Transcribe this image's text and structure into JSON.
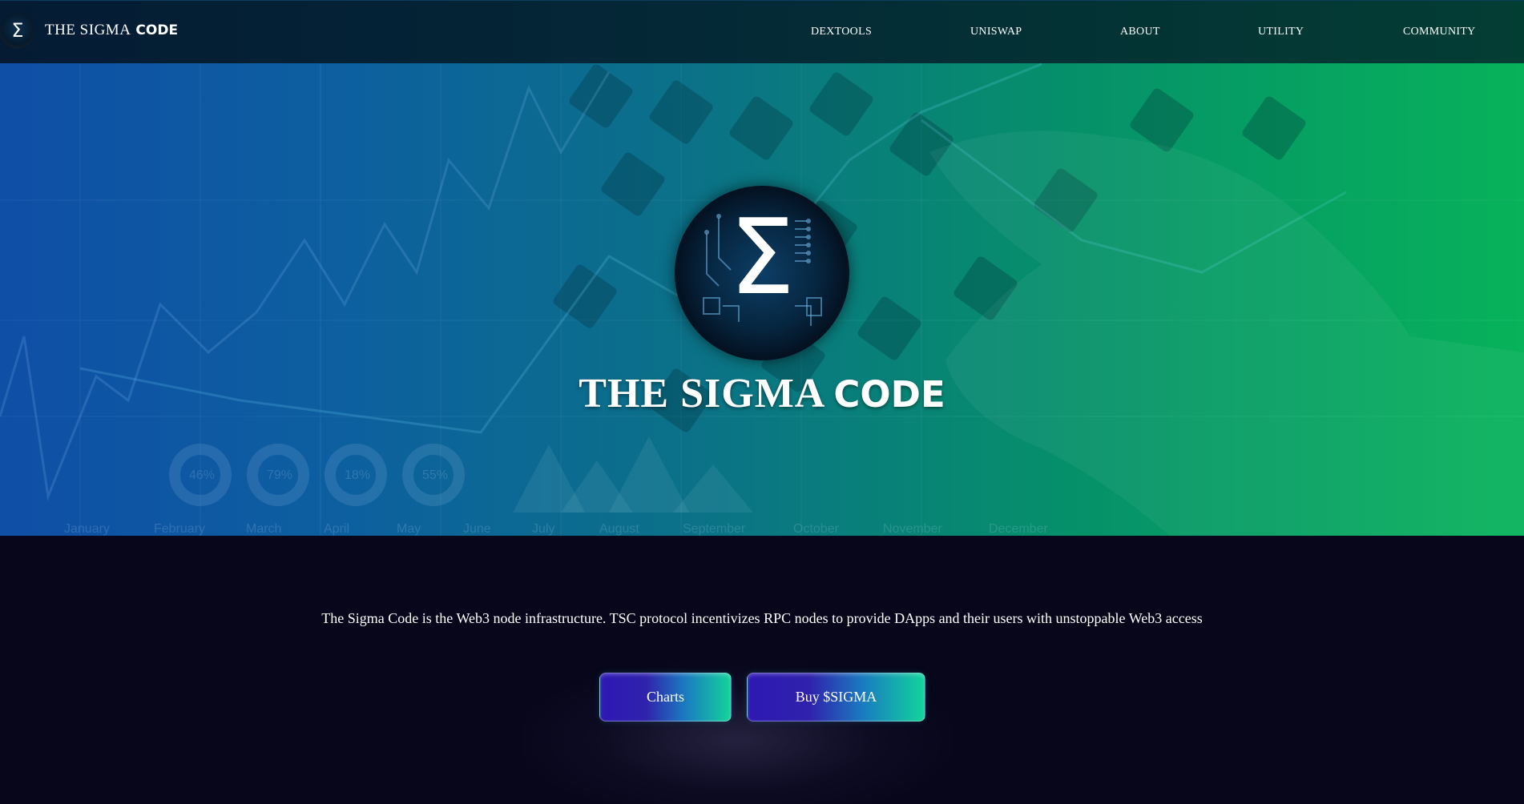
{
  "brand": {
    "logo_glyph": "Σ",
    "name_part1": "THE SIGMA",
    "name_part2": "CODE"
  },
  "nav": {
    "items": [
      {
        "label": "DEXTOOLS"
      },
      {
        "label": "UNISWAP"
      },
      {
        "label": "ABOUT"
      },
      {
        "label": "UTILITY"
      },
      {
        "label": "COMMUNITY"
      }
    ]
  },
  "hero": {
    "logo_glyph": "Σ",
    "title_part1": "THE SIGMA",
    "title_part2": "CODE",
    "background_chart": {
      "months": [
        "January",
        "February",
        "March",
        "April",
        "May",
        "June",
        "July",
        "August",
        "September",
        "October",
        "November",
        "December"
      ],
      "donut_labels": [
        "46%",
        "79%",
        "18%",
        "55%"
      ]
    }
  },
  "main": {
    "tagline": "The Sigma Code is the Web3 node infrastructure. TSC protocol incentivizes RPC nodes to provide DApps and their users with unstoppable Web3 access",
    "buttons": {
      "charts": "Charts",
      "buy": "Buy $SIGMA"
    }
  },
  "colors": {
    "hero_gradient_left": "#0f4fa6",
    "hero_gradient_right": "#07b25a",
    "page_background": "#07061a",
    "button_gradient_left": "#2e18b4",
    "button_gradient_right": "#12d49a"
  }
}
